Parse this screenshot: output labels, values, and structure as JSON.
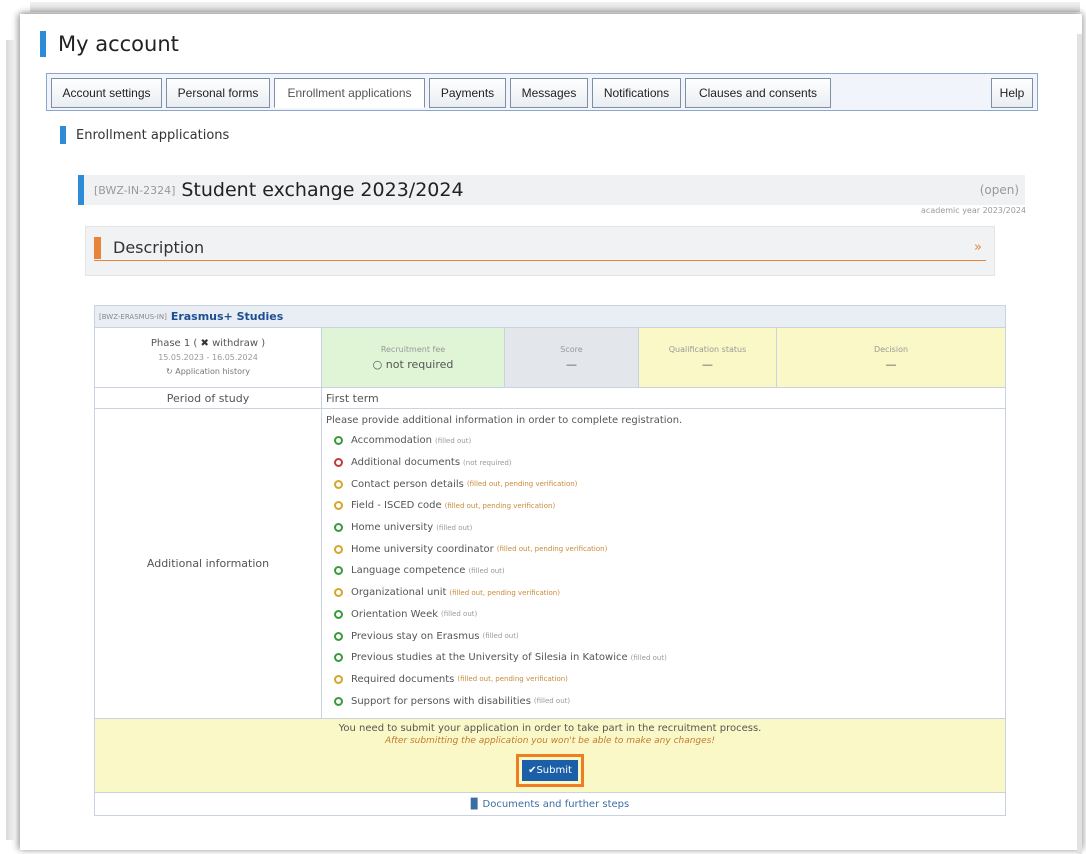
{
  "page": {
    "title": "My account"
  },
  "tabs": [
    {
      "label": "Account settings"
    },
    {
      "label": "Personal forms"
    },
    {
      "label": "Enrollment applications"
    },
    {
      "label": "Payments"
    },
    {
      "label": "Messages"
    },
    {
      "label": "Notifications"
    },
    {
      "label": "Clauses and consents"
    },
    {
      "label": "Help"
    }
  ],
  "section": {
    "title": "Enrollment applications"
  },
  "application": {
    "code": "[BWZ-IN-2324]",
    "name": "Student exchange 2023/2024",
    "status": "(open)",
    "academic_year": "academic year 2023/2024"
  },
  "description": {
    "title": "Description",
    "chevron": "»"
  },
  "registration": {
    "code": "[BWZ-ERASMUS-IN]",
    "name": "Erasmus+ Studies",
    "phase": {
      "label": "Phase 1",
      "withdraw": "withdraw",
      "dates": "15.05.2023 - 16.05.2024",
      "history": "Application history"
    },
    "fee": {
      "label": "Recruitment fee",
      "value": "not required"
    },
    "score": {
      "label": "Score",
      "value": "—"
    },
    "qualification": {
      "label": "Qualification status",
      "value": "—"
    },
    "decision": {
      "label": "Decision",
      "value": "—"
    },
    "period": {
      "label": "Period of study",
      "value": "First term"
    },
    "info": {
      "label": "Additional information",
      "intro": "Please provide additional information in order to complete registration.",
      "items": [
        {
          "name": "Accommodation",
          "status": "(filled out)",
          "color": "green"
        },
        {
          "name": "Additional documents",
          "status": "(not required)",
          "color": "red"
        },
        {
          "name": "Contact person details",
          "status": "(filled out, pending verification)",
          "color": "yellow"
        },
        {
          "name": "Field - ISCED code",
          "status": "(filled out, pending verification)",
          "color": "yellow"
        },
        {
          "name": "Home university",
          "status": "(filled out)",
          "color": "green"
        },
        {
          "name": "Home university coordinator",
          "status": "(filled out, pending verification)",
          "color": "yellow"
        },
        {
          "name": "Language competence",
          "status": "(filled out)",
          "color": "green"
        },
        {
          "name": "Organizational unit",
          "status": "(filled out, pending verification)",
          "color": "yellow"
        },
        {
          "name": "Orientation Week",
          "status": "(filled out)",
          "color": "green"
        },
        {
          "name": "Previous stay on Erasmus",
          "status": "(filled out)",
          "color": "green"
        },
        {
          "name": "Previous studies at the University of Silesia in Katowice",
          "status": "(filled out)",
          "color": "green"
        },
        {
          "name": "Required documents",
          "status": "(filled out, pending verification)",
          "color": "yellow"
        },
        {
          "name": "Support for persons with disabilities",
          "status": "(filled out)",
          "color": "green"
        }
      ]
    },
    "submit": {
      "notice": "You need to submit your application in order to take part in the recruitment process.",
      "warning": "After submitting the application you won't be able to make any changes!",
      "button": "Submit"
    },
    "docs_link": "Documents and further steps"
  },
  "colors": {
    "accent": "#2e8bd8",
    "orange": "#e8833a",
    "green": "#3a9a3a",
    "red": "#c23b3b",
    "yellow": "#d6a52a"
  }
}
